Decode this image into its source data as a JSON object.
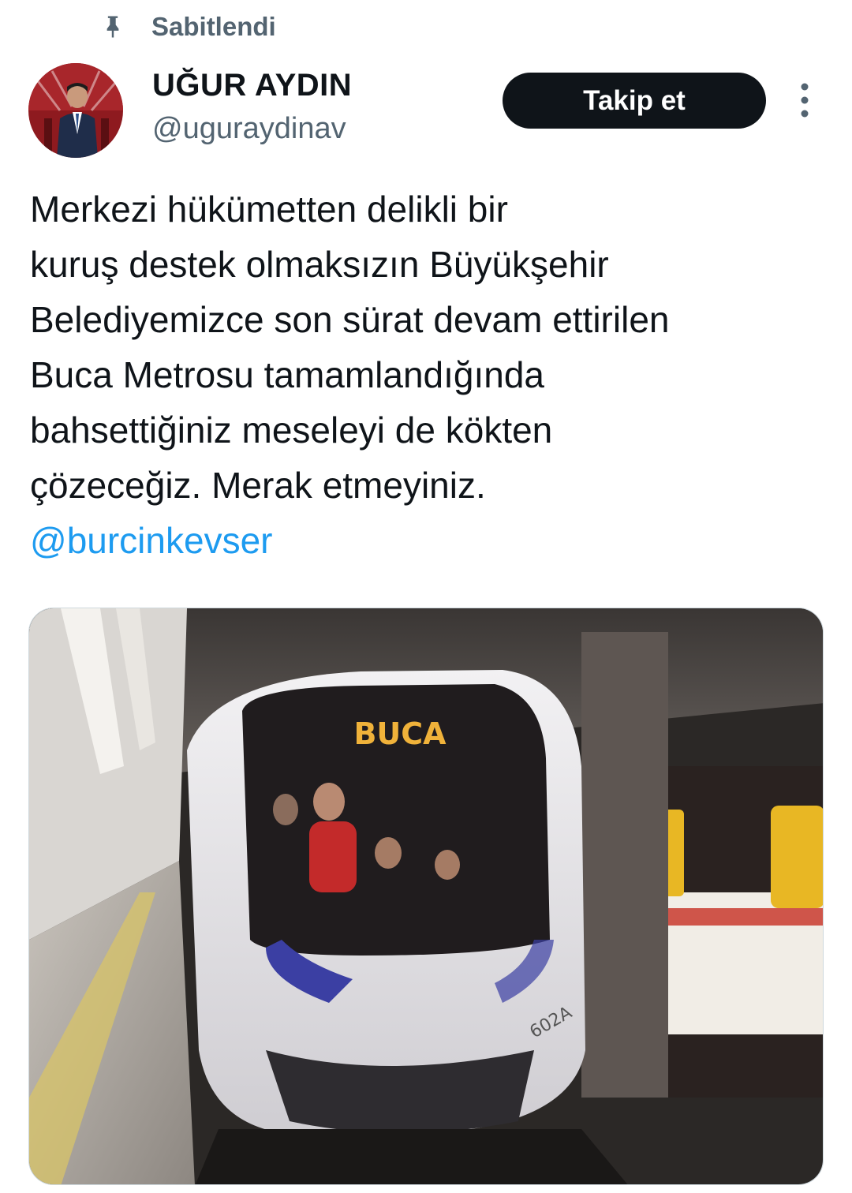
{
  "pinned": {
    "label": "Sabitlendi",
    "icon": "pin-icon"
  },
  "author": {
    "name": "UĞUR AYDIN",
    "handle": "@uguraydinav"
  },
  "follow_button": {
    "label": "Takip et"
  },
  "more_icon": "more-vertical-icon",
  "tweet": {
    "lines": [
      "Merkezi hükümetten delikli bir",
      "kuruş destek olmaksızın Büyükşehir",
      "Belediyemizce son sürat devam ettirilen",
      "Buca Metrosu tamamlandığında",
      "bahsettiğiniz meseleyi de kökten",
      "çözeceğiz. Merak etmeyiniz."
    ],
    "mention": "@burcinkevser"
  },
  "media": {
    "destination_sign": "BUCA",
    "train_number": "602A"
  },
  "colors": {
    "text": "#0f1419",
    "secondary": "#536471",
    "link": "#1d9bf0",
    "button_bg": "#0f1419"
  }
}
